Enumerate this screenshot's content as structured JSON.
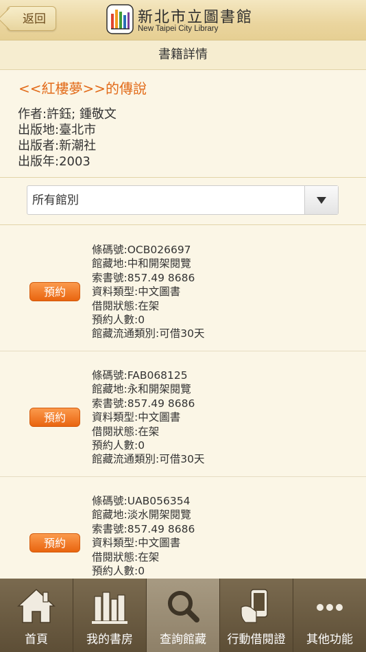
{
  "header": {
    "back_label": "返回",
    "logo_cn": "新北市立圖書館",
    "logo_en": "New Taipei City Library"
  },
  "page_title": "書籍詳情",
  "book": {
    "title": "<<紅樓夢>>的傳說",
    "author": "作者:許鈺; 鍾敬文",
    "place": "出版地:臺北市",
    "publisher": "出版者:新潮社",
    "year": "出版年:2003"
  },
  "branch_select": {
    "value": "所有館別"
  },
  "reserve_label": "預約",
  "holdings": [
    {
      "barcode": "條碼號:OCB026697",
      "location": "館藏地:中和開架閱覽",
      "call_no": "索書號:857.49 8686",
      "type": "資料類型:中文圖書",
      "status": "借閱狀態:在架",
      "reservations": "預約人數:0",
      "circulation": "館藏流通類別:可借30天"
    },
    {
      "barcode": "條碼號:FAB068125",
      "location": "館藏地:永和開架閱覽",
      "call_no": "索書號:857.49 8686",
      "type": "資料類型:中文圖書",
      "status": "借閱狀態:在架",
      "reservations": "預約人數:0",
      "circulation": "館藏流通類別:可借30天"
    },
    {
      "barcode": "條碼號:UAB056354",
      "location": "館藏地:淡水開架閱覽",
      "call_no": "索書號:857.49 8686",
      "type": "資料類型:中文圖書",
      "status": "借閱狀態:在架",
      "reservations": "預約人數:0",
      "circulation": ""
    }
  ],
  "tabs": [
    {
      "label": "首頁",
      "icon": "home-icon"
    },
    {
      "label": "我的書房",
      "icon": "bookshelf-icon"
    },
    {
      "label": "查詢館藏",
      "icon": "search-icon"
    },
    {
      "label": "行動借閱證",
      "icon": "mobile-card-icon"
    },
    {
      "label": "其他功能",
      "icon": "more-icon"
    }
  ],
  "colors": {
    "accent": "#e26a18",
    "reserve_button": "#f07a22",
    "tabbar": "#6a5a40"
  }
}
